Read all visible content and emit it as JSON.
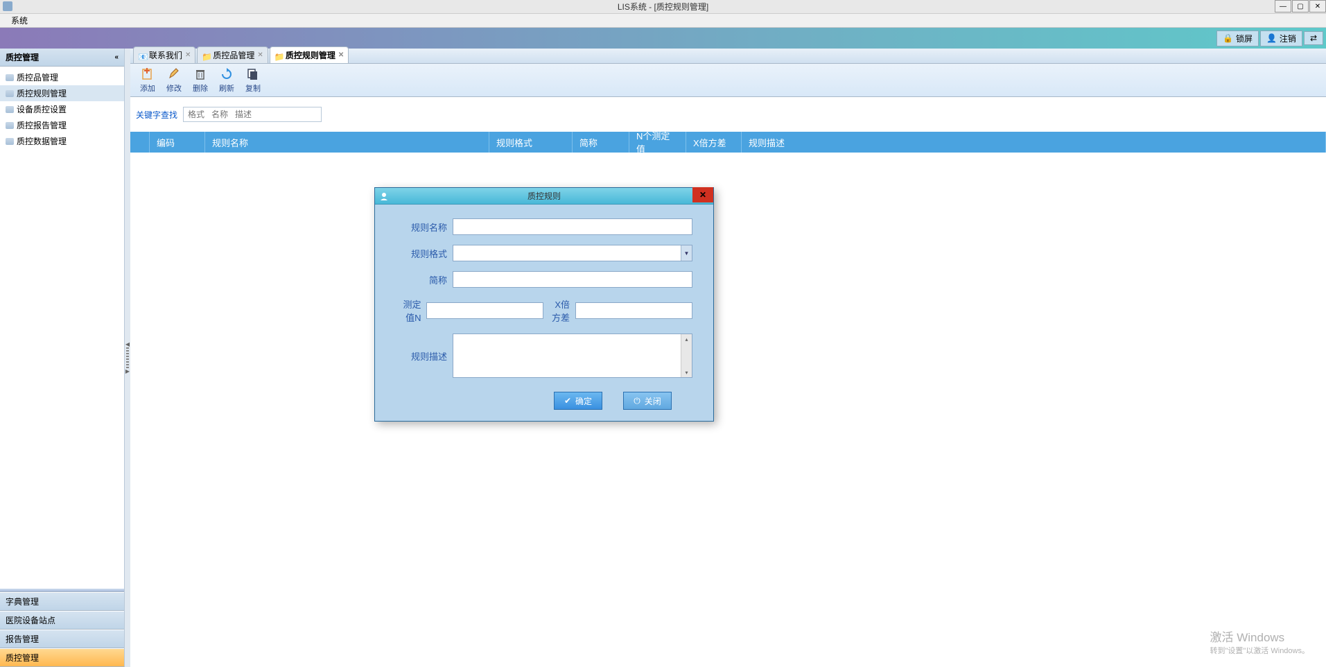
{
  "window": {
    "title": "LIS系统 - [质控规则管理]"
  },
  "menubar": {
    "items": [
      "系统"
    ]
  },
  "ribbon": {
    "lock": "锁屏",
    "logout": "注销"
  },
  "sidebar": {
    "header": "质控管理",
    "items": [
      {
        "label": "质控品管理"
      },
      {
        "label": "质控规则管理"
      },
      {
        "label": "设备质控设置"
      },
      {
        "label": "质控报告管理"
      },
      {
        "label": "质控数据管理"
      }
    ],
    "footer": [
      {
        "label": "字典管理"
      },
      {
        "label": "医院设备站点"
      },
      {
        "label": "报告管理"
      },
      {
        "label": "质控管理"
      }
    ]
  },
  "tabs": {
    "items": [
      {
        "label": "联系我们"
      },
      {
        "label": "质控品管理"
      },
      {
        "label": "质控规则管理"
      }
    ]
  },
  "toolbar": {
    "add": "添加",
    "edit": "修改",
    "del": "删除",
    "refresh": "刷新",
    "copy": "复制"
  },
  "search": {
    "label": "关键字查找",
    "placeholder": "格式   名称   描述"
  },
  "table": {
    "columns": [
      "",
      "编码",
      "规则名称",
      "规则格式",
      "简称",
      "N个测定值",
      "X倍方差",
      "规则描述"
    ]
  },
  "dialog": {
    "title": "质控规则",
    "fields": {
      "ruleName": "规则名称",
      "ruleFormat": "规则格式",
      "shortName": "简称",
      "nValue": "测定值N",
      "xVariance": "X倍方差",
      "ruleDesc": "规则描述"
    },
    "buttons": {
      "ok": "确定",
      "close": "关闭"
    }
  },
  "watermark": {
    "line1": "激活 Windows",
    "line2": "转到\"设置\"以激活 Windows。"
  }
}
